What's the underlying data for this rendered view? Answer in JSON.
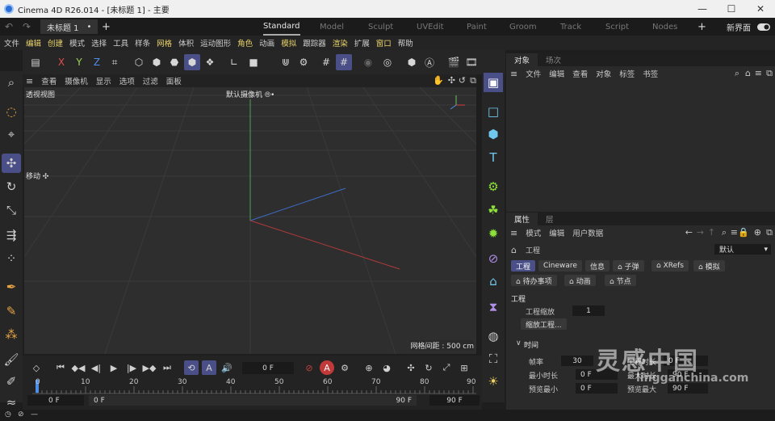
{
  "window": {
    "title": "Cinema 4D R26.014 - [未标题 1] - 主要",
    "min": "—",
    "max": "☐",
    "close": "✕"
  },
  "doc_tab": {
    "label": "未标题 1",
    "close": "•"
  },
  "layouts": [
    "Standard",
    "Model",
    "Sculpt",
    "UVEdit",
    "Paint",
    "Groom",
    "Track",
    "Script",
    "Nodes"
  ],
  "active_layout": "Standard",
  "new_layout": "新界面",
  "menu": [
    "文件",
    "编辑",
    "创建",
    "模式",
    "选择",
    "工具",
    "样条",
    "网格",
    "体积",
    "运动图形",
    "角色",
    "动画",
    "模拟",
    "跟踪器",
    "渲染",
    "扩展",
    "窗口",
    "帮助"
  ],
  "viewport": {
    "menu": [
      "查看",
      "摄像机",
      "显示",
      "选项",
      "过滤",
      "面板"
    ],
    "name": "透视视图",
    "camera": "默认摄像机 ⦾•",
    "grid_info": "网格间距 : 500 cm",
    "move_label": "移动 ✣"
  },
  "timeline": {
    "current_frame": "0 F",
    "ticks": [
      "0",
      "10",
      "20",
      "30",
      "40",
      "50",
      "60",
      "70",
      "80",
      "90"
    ],
    "start": "0 F",
    "start2": "0 F",
    "end": "90 F",
    "end2": "90 F"
  },
  "objects_panel": {
    "tabs": [
      "对象",
      "场次"
    ],
    "menu": [
      "文件",
      "编辑",
      "查看",
      "对象",
      "标签",
      "书签"
    ]
  },
  "attributes_panel": {
    "tabs": [
      "属性",
      "层"
    ],
    "menu": [
      "模式",
      "编辑",
      "用户数据"
    ],
    "object": "工程",
    "preset": "默认",
    "chips_row1": [
      "工程",
      "Cineware",
      "信息",
      "⌂ 子弹",
      "⌂ XRefs",
      "⌂ 模拟"
    ],
    "chips_row2": [
      "⌂ 待办事项",
      "⌂ 动画",
      "⌂ 节点"
    ],
    "section": "工程",
    "scale_label": "工程缩放",
    "scale_value": "1",
    "scale_button": "缩放工程...",
    "time_section": "时间",
    "fps_label": "帧率",
    "fps_value": "30",
    "project_time_label": "工程时长",
    "project_time_value": "0 F",
    "min_label": "最小时长",
    "min_value": "0 F",
    "max_label": "最大时长",
    "max_value": "90 F",
    "pmin_label": "预览最小",
    "pmin_value": "0 F",
    "pmax_label": "预览最大",
    "pmax_value": "90 F"
  },
  "watermark": {
    "brand": "灵感中国",
    "url": "lingganchina.com"
  },
  "colors": {
    "accent": "#4a4f87",
    "x_axis": "#e34b4b",
    "y_axis": "#7fd05a",
    "z_axis": "#4f8ee8",
    "highlight_menu": "#e9d36b"
  }
}
